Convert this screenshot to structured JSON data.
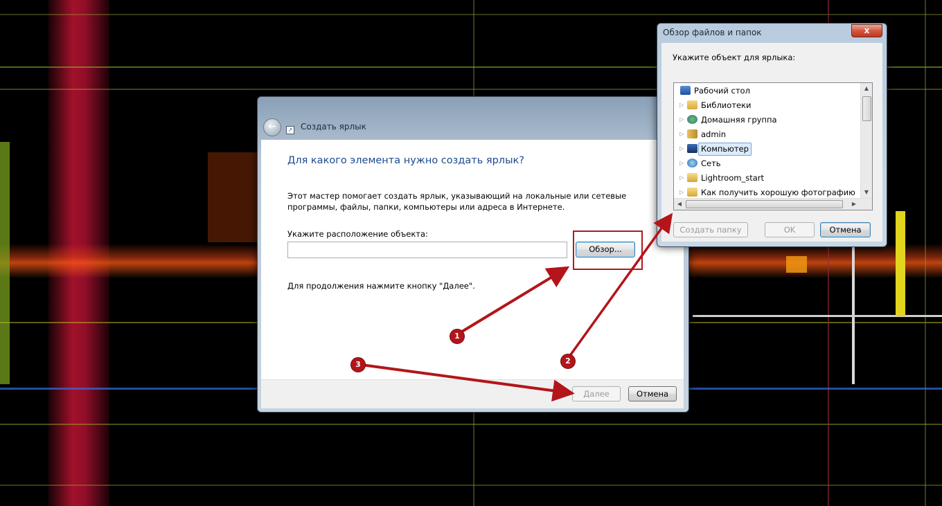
{
  "wizard": {
    "title": "Создать ярлык",
    "heading": "Для какого элемента нужно создать ярлык?",
    "description": "Этот мастер помогает создать ярлык, указывающий на локальные или сетевые программы, файлы, папки, компьютеры или адреса в Интернете.",
    "location_label": "Укажите расположение объекта:",
    "location_value": "",
    "browse_button": "Обзор...",
    "continue_hint": "Для продолжения нажмите кнопку \"Далее\".",
    "next_button": "Далее",
    "cancel_button": "Отмена"
  },
  "browse_dialog": {
    "title": "Обзор файлов и папок",
    "close_label": "x",
    "prompt": "Укажите объект для ярлыка:",
    "tree_items": [
      {
        "label": "Рабочий стол",
        "icon": "desktop-icon",
        "expandable": false,
        "selected": false
      },
      {
        "label": "Библиотеки",
        "icon": "libraries-icon",
        "expandable": true,
        "selected": false
      },
      {
        "label": "Домашняя группа",
        "icon": "homegroup-icon",
        "expandable": true,
        "selected": false
      },
      {
        "label": "admin",
        "icon": "user-folder-icon",
        "expandable": true,
        "selected": false
      },
      {
        "label": "Компьютер",
        "icon": "computer-icon",
        "expandable": true,
        "selected": true
      },
      {
        "label": "Сеть",
        "icon": "network-icon",
        "expandable": true,
        "selected": false
      },
      {
        "label": "Lightroom_start",
        "icon": "folder-icon",
        "expandable": true,
        "selected": false
      },
      {
        "label": "Как получить хорошую фотографию",
        "icon": "folder-icon",
        "expandable": true,
        "selected": false
      }
    ],
    "new_folder_button": "Создать папку",
    "ok_button": "OK",
    "cancel_button": "Отмена"
  },
  "annotations": {
    "badges": [
      "1",
      "2",
      "3"
    ],
    "arrow_color": "#b3151a"
  },
  "colors": {
    "heading": "#1c4a8e",
    "selection": "#dcebfc"
  }
}
